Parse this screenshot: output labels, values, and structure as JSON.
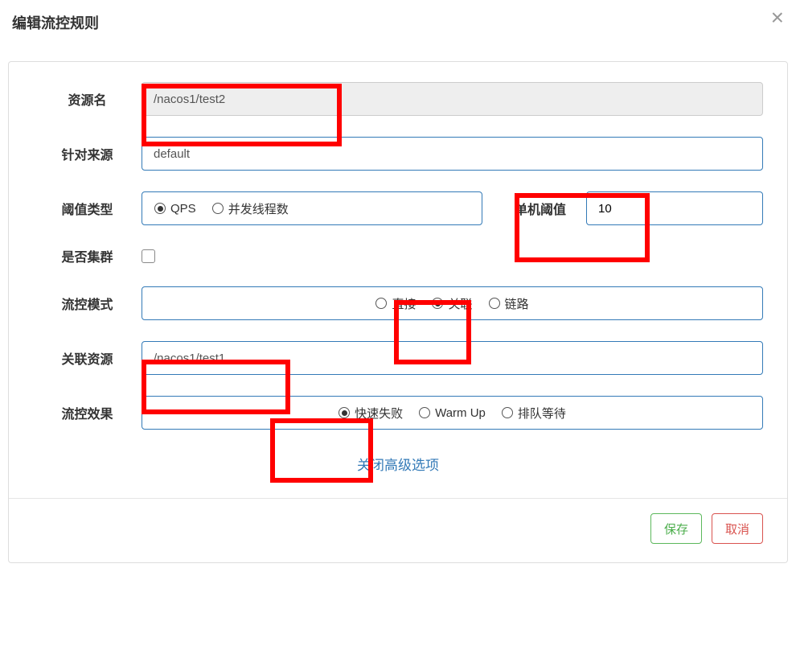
{
  "modal": {
    "title": "编辑流控规则",
    "close_advanced_label": "关闭高级选项"
  },
  "labels": {
    "resource": "资源名",
    "source": "针对来源",
    "threshold_type": "阈值类型",
    "single_threshold": "单机阈值",
    "is_cluster": "是否集群",
    "flow_mode": "流控模式",
    "related_resource": "关联资源",
    "flow_effect": "流控效果"
  },
  "values": {
    "resource": "/nacos1/test2",
    "source": "default",
    "threshold_type_selected": "qps",
    "single_threshold": "10",
    "is_cluster": false,
    "flow_mode_selected": "related",
    "related_resource": "/nacos1/test1",
    "flow_effect_selected": "fail_fast"
  },
  "options": {
    "threshold_type": {
      "qps": "QPS",
      "threads": "并发线程数"
    },
    "flow_mode": {
      "direct": "直接",
      "related": "关联",
      "chain": "链路"
    },
    "flow_effect": {
      "fail_fast": "快速失败",
      "warmup": "Warm Up",
      "queue": "排队等待"
    }
  },
  "buttons": {
    "save": "保存",
    "cancel": "取消"
  }
}
